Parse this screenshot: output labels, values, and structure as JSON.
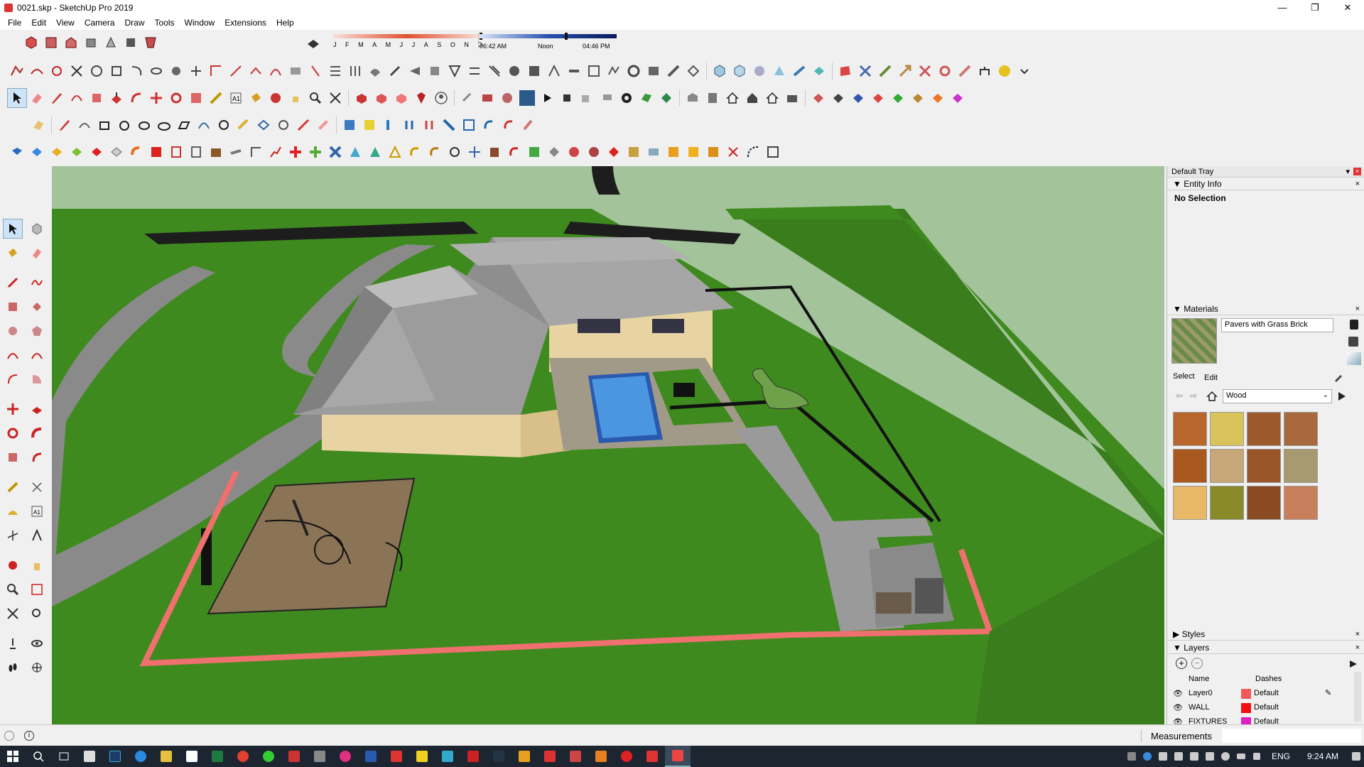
{
  "window": {
    "title": "0021.skp - SketchUp Pro 2019",
    "minimize": "—",
    "maximize": "❐",
    "close": "✕"
  },
  "menu": [
    "File",
    "Edit",
    "View",
    "Camera",
    "Draw",
    "Tools",
    "Window",
    "Extensions",
    "Help"
  ],
  "shadow_toolbar": {
    "months": [
      "J",
      "F",
      "M",
      "A",
      "M",
      "J",
      "J",
      "A",
      "S",
      "O",
      "N",
      "D"
    ],
    "time_start": "06:42 AM",
    "time_mid": "Noon",
    "time_end": "04:46 PM"
  },
  "tray": {
    "title": "Default Tray",
    "entity_info": {
      "header": "Entity Info",
      "selection": "No Selection"
    },
    "materials": {
      "header": "Materials",
      "current_material": "Pavers with Grass Brick",
      "tab_select": "Select",
      "tab_edit": "Edit",
      "library": "Wood",
      "swatch_colors": [
        "#b8662c",
        "#d9c45c",
        "#9c5a2c",
        "#a86a3c",
        "#a8581c",
        "#c8a878",
        "#9a5528",
        "#a89a70",
        "#e8b868",
        "#8a8a2a",
        "#8a4a22",
        "#c8805c"
      ]
    },
    "styles": {
      "header": "Styles"
    },
    "layers": {
      "header": "Layers",
      "col_name": "Name",
      "col_dashes": "Dashes",
      "rows": [
        {
          "name": "Layer0",
          "dashes": "Default",
          "color": "#f25a5a"
        },
        {
          "name": "WALL",
          "dashes": "Default",
          "color": "#f01010"
        },
        {
          "name": "FIXTURES",
          "dashes": "Default",
          "color": "#e020c0"
        }
      ]
    }
  },
  "status": {
    "measurements_label": "Measurements"
  },
  "taskbar": {
    "lang": "ENG",
    "time": "9:24 AM"
  },
  "colors": {
    "grass": "#3f8a1f",
    "paving": "#8e8e8e",
    "roof": "#9a9a9a",
    "pool": "#3a86d4",
    "wall": "#f07070",
    "court": "#8b7355"
  }
}
